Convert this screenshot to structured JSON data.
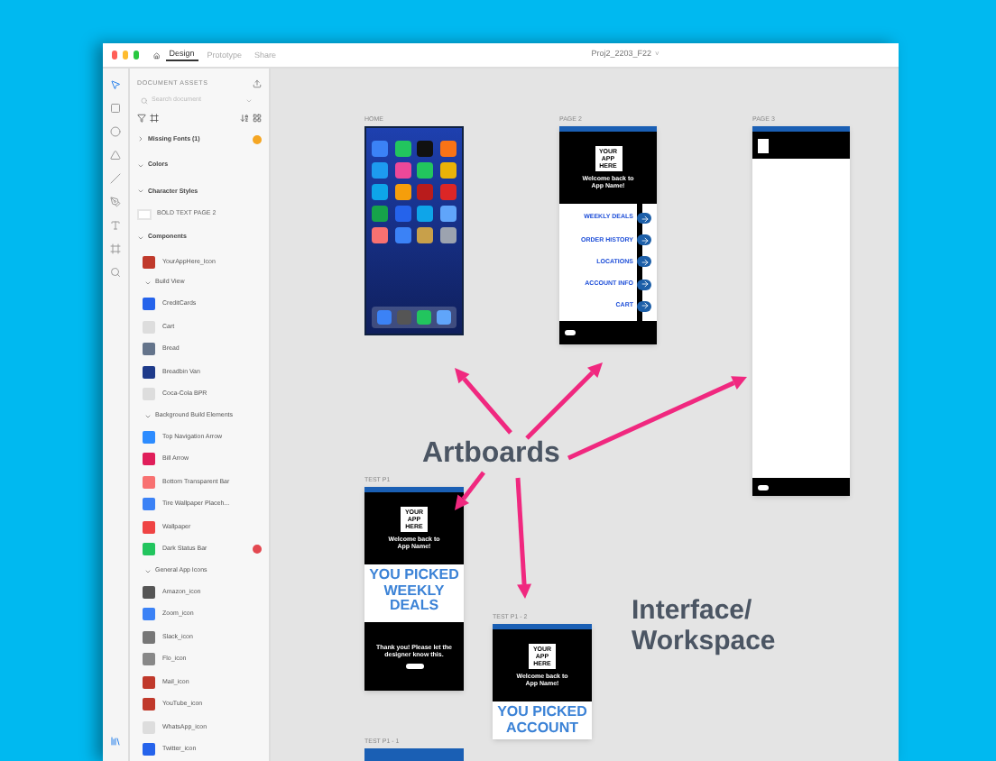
{
  "window": {
    "title": "Proj2_2203_F22",
    "title_caret": "˅",
    "tabs": [
      {
        "label": "Design",
        "selected": true
      },
      {
        "label": "Prototype",
        "selected": false
      },
      {
        "label": "Share",
        "selected": false
      }
    ]
  },
  "assets": {
    "title": "DOCUMENT ASSETS",
    "search_placeholder": "Search document",
    "rows": [
      {
        "kind": "group",
        "label": "Missing Fonts (1)",
        "expanded": false,
        "warning": true
      },
      {
        "kind": "group",
        "label": "Colors",
        "expanded": true
      },
      {
        "kind": "group",
        "label": "Character Styles",
        "expanded": true
      },
      {
        "kind": "style",
        "label": "BOLD TEXT PAGE 2"
      },
      {
        "kind": "group",
        "label": "Components",
        "expanded": true
      },
      {
        "kind": "component",
        "label": "YourAppHere_Icon"
      },
      {
        "kind": "subgroup",
        "label": "Build View",
        "expanded": true
      },
      {
        "kind": "component",
        "label": "CreditCards"
      },
      {
        "kind": "component",
        "label": "Cart"
      },
      {
        "kind": "component",
        "label": "Bread"
      },
      {
        "kind": "component",
        "label": "Breadbin Van"
      },
      {
        "kind": "component",
        "label": "Coca-Cola BPR"
      },
      {
        "kind": "subgroup",
        "label": "Background Build Elements",
        "expanded": true
      },
      {
        "kind": "component",
        "label": "Top Navigation Arrow"
      },
      {
        "kind": "component",
        "label": "Bill Arrow"
      },
      {
        "kind": "component",
        "label": "Bottom Transparent Bar"
      },
      {
        "kind": "component",
        "label": "Tire Wallpaper Placeh..."
      },
      {
        "kind": "component",
        "label": "Wallpaper"
      },
      {
        "kind": "component",
        "label": "Dark Status Bar",
        "error": true
      },
      {
        "kind": "subgroup",
        "label": "General App Icons",
        "expanded": true
      },
      {
        "kind": "component",
        "label": "Amazon_icon"
      },
      {
        "kind": "component",
        "label": "Zoom_icon"
      },
      {
        "kind": "component",
        "label": "Slack_icon"
      },
      {
        "kind": "component",
        "label": "Flo_icon"
      },
      {
        "kind": "component",
        "label": "Mail_icon"
      },
      {
        "kind": "component",
        "label": "YouTube_icon"
      },
      {
        "kind": "component",
        "label": "WhatsApp_icon"
      },
      {
        "kind": "component",
        "label": "Twitter_icon"
      }
    ]
  },
  "canvas": {
    "artboards": [
      {
        "kind": "home",
        "label": "HOME"
      },
      {
        "kind": "menu",
        "label": "PAGE 2",
        "logo": "YOUR APP HERE",
        "welcome": "Welcome back to App Name!",
        "menu_items": [
          "WEEKLY DEALS",
          "ORDER HISTORY",
          "LOCATIONS",
          "ACCOUNT INFO",
          "CART"
        ]
      },
      {
        "kind": "blank",
        "label": "PAGE 3"
      },
      {
        "kind": "result",
        "label": "TEST P1",
        "logo": "YOUR APP HERE",
        "welcome": "Welcome back to App Name!",
        "headline": "YOU PICKED WEEKLY DEALS",
        "thanks": "Thank you! Please let the designer know this."
      },
      {
        "kind": "result",
        "label": "TEST P1 - 2",
        "logo": "YOUR APP HERE",
        "welcome": "Welcome back to App Name!",
        "headline": "YOU PICKED ACCOUNT"
      },
      {
        "kind": "stub",
        "label": "TEST P1 - 1"
      }
    ]
  },
  "annotations": [
    {
      "text": "Artboards"
    },
    {
      "text": "Interface/ Workspace"
    }
  ]
}
